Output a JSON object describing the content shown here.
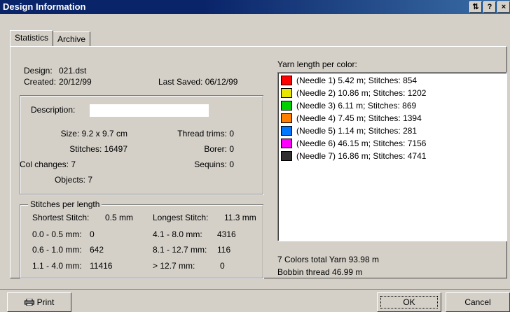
{
  "window": {
    "title": "Design Information",
    "title_buttons": [
      "⇅",
      "?",
      "×"
    ]
  },
  "tabs": [
    {
      "label": "Statistics",
      "active": true
    },
    {
      "label": "Archive",
      "active": false
    }
  ],
  "design": {
    "design_label": "Design:",
    "design_value": "021.dst",
    "created_label": "Created:",
    "created_value": "20/12/99",
    "last_saved": "Last Saved: 06/12/99"
  },
  "description": {
    "label": "Description:",
    "value": ""
  },
  "stats": {
    "size": "Size: 9.2 x 9.7 cm",
    "stitches": "Stitches: 16497",
    "col_changes": "Col changes: 7",
    "objects": "Objects: 7",
    "thread_trims": "Thread trims: 0",
    "borer": "Borer: 0",
    "sequins": "Sequins: 0"
  },
  "stitches_per_length": {
    "title": "Stitches per length",
    "shortest_label": "Shortest Stitch:",
    "shortest_value": "0.5 mm",
    "longest_label": "Longest Stitch:",
    "longest_value": "11.3 mm",
    "ranges": [
      {
        "label": "0.0 - 0.5 mm:",
        "value": "0"
      },
      {
        "label": "0.6 - 1.0 mm:",
        "value": "642"
      },
      {
        "label": "1.1 - 4.0 mm:",
        "value": "11416"
      },
      {
        "label": "4.1 - 8.0 mm:",
        "value": "4316"
      },
      {
        "label": "8.1 - 12.7 mm:",
        "value": "116"
      },
      {
        "label": "> 12.7 mm:",
        "value": "0"
      }
    ]
  },
  "yarn": {
    "header": "Yarn length per color:",
    "colors": [
      {
        "text": "(Needle 1)  5.42 m; Stitches: 854",
        "color": "#ff0000"
      },
      {
        "text": "(Needle 2)  10.86 m; Stitches: 1202",
        "color": "#e6e600"
      },
      {
        "text": "(Needle 3)  6.11 m; Stitches: 869",
        "color": "#00d000"
      },
      {
        "text": "(Needle 4)  7.45 m; Stitches: 1394",
        "color": "#ff8000"
      },
      {
        "text": "(Needle 5)  1.14 m; Stitches: 281",
        "color": "#0078ff"
      },
      {
        "text": "(Needle 6)  46.15 m; Stitches: 7156",
        "color": "#ff00ff"
      },
      {
        "text": "(Needle 7)  16.86 m; Stitches: 4741",
        "color": "#303030"
      }
    ],
    "total": "7 Colors total Yarn 93.98 m",
    "bobbin": "Bobbin thread 46.99 m"
  },
  "buttons": {
    "print": "Print",
    "ok": "OK",
    "cancel": "Cancel"
  }
}
